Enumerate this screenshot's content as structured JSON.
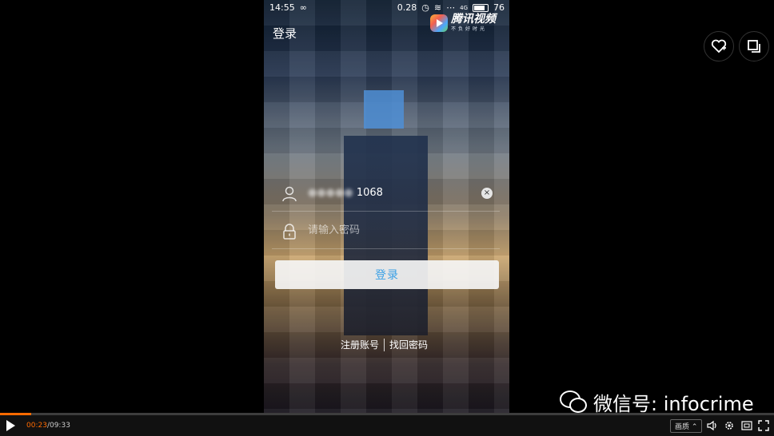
{
  "status_bar": {
    "time": "14:55",
    "data_rate": "0.28",
    "network": "4G",
    "battery": "76"
  },
  "app": {
    "title": "登录",
    "logo_text": "腾讯视频",
    "logo_sub": "不负好时光"
  },
  "login": {
    "account_value": "1068",
    "password_placeholder": "请输入密码",
    "button_label": "登录",
    "register_link": "注册账号",
    "forgot_link": "找回密码"
  },
  "watermark": {
    "text": "微信号: infocrime"
  },
  "player": {
    "current_time": "00:23",
    "total_time": "09:33",
    "progress_fraction": 0.04,
    "quality_label": "画质",
    "accent_color": "#ff6a00"
  }
}
